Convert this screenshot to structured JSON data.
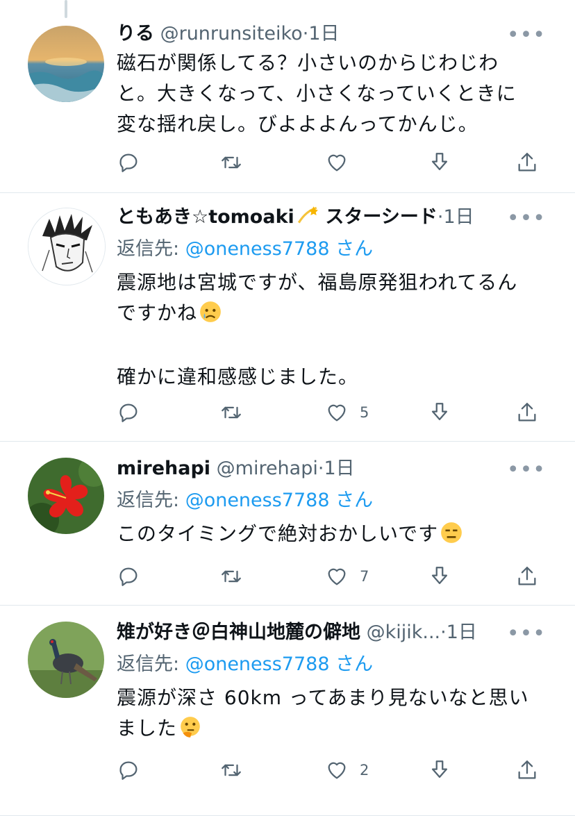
{
  "tweets": [
    {
      "name": "りる",
      "handle": "@runrunsiteiko",
      "separator": "·",
      "time": "1日",
      "more": "•••",
      "reply_prefix": "",
      "reply_mention": "",
      "reply_suffix": "",
      "lines": [
        "磁石が関係してる？小さいのからじわじわ",
        "と。大きくなって、小さくなっていくときに",
        "変な揺れ戻し。びよよよんってかんじ。"
      ],
      "like_count": "",
      "avatar_icon": "ocean-sunset-avatar"
    },
    {
      "name": "ともあき☆tomoaki",
      "name_suffix": "スターシード",
      "handle": "",
      "separator": "·",
      "time": "1日",
      "more": "•••",
      "reply_prefix": "返信先: ",
      "reply_mention": "@oneness7788",
      "reply_suffix": " さん",
      "lines": [
        "震源地は宮城ですが、福島原発狙われてるん",
        "ですかね",
        "",
        "確かに違和感感じました。"
      ],
      "like_count": "5",
      "avatar_icon": "manga-face-avatar",
      "name_emoji": "dizzy-star-emoji",
      "text_emoji": "crying-face-emoji"
    },
    {
      "name": "mirehapi",
      "handle": "@mirehapi",
      "separator": "·",
      "time": "1日",
      "more": "•••",
      "reply_prefix": "返信先: ",
      "reply_mention": "@oneness7788",
      "reply_suffix": " さん",
      "lines": [
        "このタイミングで絶対おかしいです"
      ],
      "like_count": "7",
      "avatar_icon": "red-hibiscus-avatar",
      "text_emoji": "expressionless-face-emoji"
    },
    {
      "name": "雉が好き＠白神山地麓の僻地",
      "handle": "@kijik...",
      "separator": "·",
      "time": "1日",
      "more": "•••",
      "reply_prefix": "返信先: ",
      "reply_mention": "@oneness7788",
      "reply_suffix": " さん",
      "lines": [
        "震源が深さ 60km ってあまり見ないなと思い",
        "ました"
      ],
      "like_count": "2",
      "avatar_icon": "pheasant-avatar",
      "text_emoji": "thinking-face-emoji"
    }
  ],
  "icons": [
    "reply-icon",
    "retweet-icon",
    "like-icon",
    "download-icon",
    "share-icon"
  ],
  "colors": {
    "accent": "#1d9bf0",
    "secondary_text": "#536471",
    "icon_gray": "#536471"
  }
}
